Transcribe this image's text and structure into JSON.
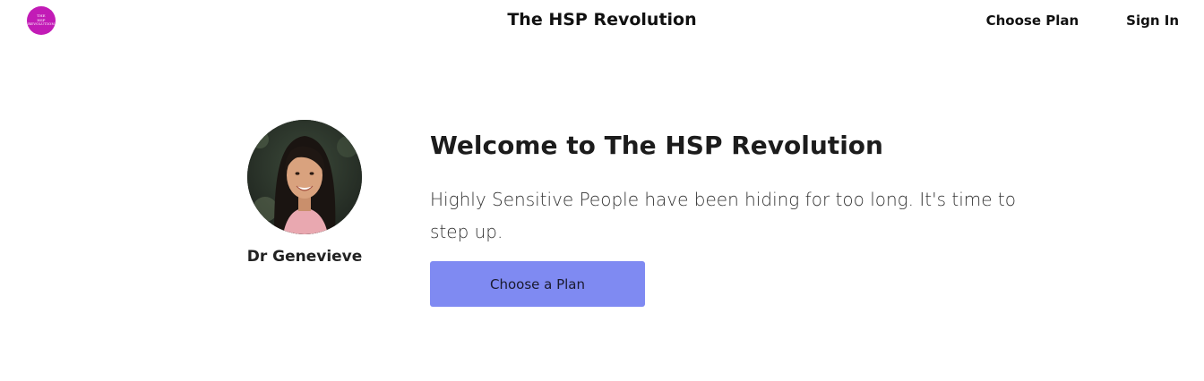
{
  "header": {
    "logo_lines": [
      "THE",
      "HSP",
      "REVOLUTION"
    ],
    "title": "The HSP Revolution",
    "nav": [
      {
        "label": "Choose Plan"
      },
      {
        "label": "Sign In"
      }
    ]
  },
  "author": {
    "name": "Dr Genevieve"
  },
  "hero": {
    "heading": "Welcome to The HSP Revolution",
    "body": "Highly Sensitive People have been hiding for too long. It's time to step up.",
    "cta_label": "Choose a Plan"
  },
  "colors": {
    "logo": "#c21bb6",
    "cta": "#7f8af2"
  }
}
